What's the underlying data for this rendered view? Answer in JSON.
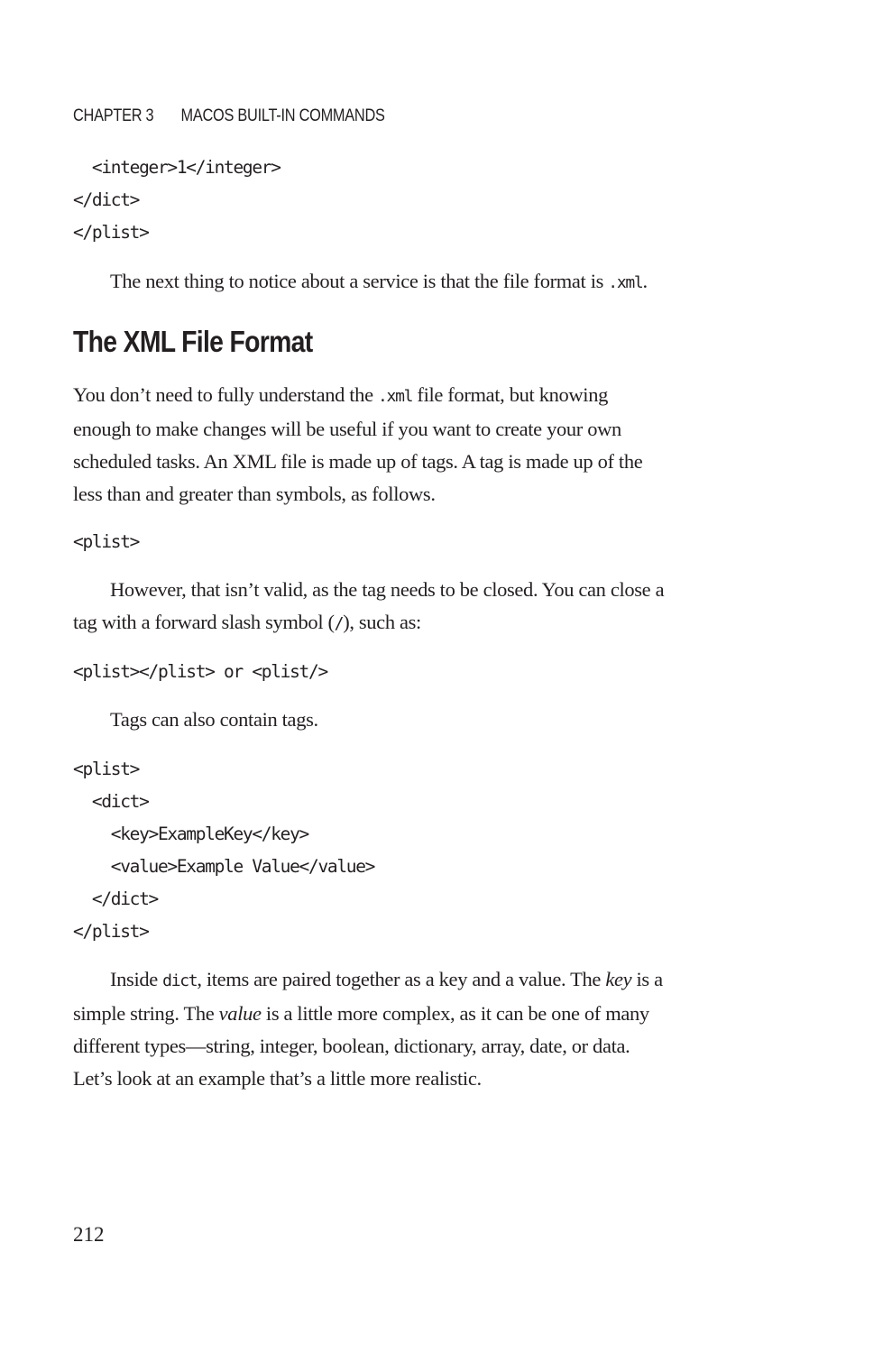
{
  "running_head": {
    "chapter": "CHAPTER 3",
    "title": "MACOS BUILT-IN COMMANDS"
  },
  "code_top": [
    "  <integer>1</integer>",
    "</dict>",
    "</plist>"
  ],
  "para1": {
    "before": "The next thing to notice about a service is that the file format is ",
    "code": ".xml",
    "after": "."
  },
  "heading": "The XML File Format",
  "para2": {
    "l1_before": "You don’t need to fully understand the ",
    "l1_code": ".xml",
    "l1_after": " file format, but knowing",
    "l2": "enough to make changes will be useful if you want to create your own",
    "l3": "scheduled tasks. An XML file is made up of tags. A tag is made up of the",
    "l4": "less than and greater than symbols, as follows."
  },
  "code_plist": "<plist>",
  "para3": {
    "l1": "However, that isn’t valid, as the tag needs to be closed. You can close a",
    "l2_before": "tag with a forward slash symbol (",
    "l2_code": "/",
    "l2_after": "), such as:"
  },
  "code_close": "<plist></plist> or <plist/>",
  "para4": "Tags can also contain tags.",
  "code_nested": [
    "<plist>",
    "  <dict>",
    "    <key>ExampleKey</key>",
    "    <value>Example Value</value>",
    "  </dict>",
    "</plist>"
  ],
  "para5": {
    "l1_before": "Inside ",
    "l1_code": "dict",
    "l1_mid": ", items are paired together as a key and a value. The ",
    "l1_em": "key",
    "l1_after": " is a",
    "l2_before": "simple string. The ",
    "l2_em": "value",
    "l2_after": " is a little more complex, as it can be one of many",
    "l3": "different types—string, integer, boolean, dictionary, array, date, or data.",
    "l4": "Let’s look at an example that’s a little more realistic."
  },
  "page_number": "212"
}
